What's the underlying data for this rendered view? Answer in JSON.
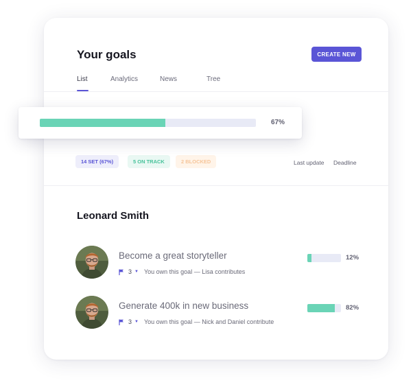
{
  "header": {
    "title": "Your goals",
    "create_label": "CREATE NEW"
  },
  "tabs": [
    {
      "label": "List",
      "active": true
    },
    {
      "label": "Analytics",
      "active": false
    },
    {
      "label": "News",
      "active": false
    },
    {
      "label": "Tree",
      "active": false
    }
  ],
  "progress": {
    "value": 0.58,
    "label": "67%"
  },
  "summary": {
    "set_label": "14 SET (67%)",
    "on_track_label": "5 ON TRACK",
    "blocked_label": "2 BLOCKED",
    "last_update_label": "Last update",
    "deadline_label": "Deadline"
  },
  "person": {
    "name": "Leonard Smith"
  },
  "goals": [
    {
      "title": "Become a great storyteller",
      "count": "3",
      "description": "You own this goal — Lisa contributes",
      "progress": 0.12,
      "progress_label": "12%"
    },
    {
      "title": "Generate 400k in new business",
      "count": "3",
      "description": "You own this goal — Nick and Daniel contribute",
      "progress": 0.82,
      "progress_label": "82%"
    }
  ],
  "colors": {
    "accent": "#5a55d6",
    "progress_fill": "#6ad4b6",
    "progress_track": "#e8eaf6",
    "on_track": "#47c29a",
    "blocked": "#f6c59a"
  }
}
